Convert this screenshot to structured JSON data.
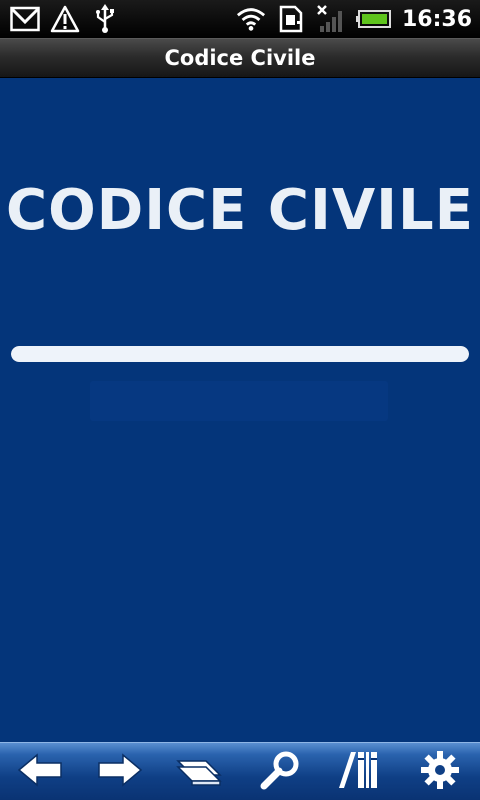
{
  "status_bar": {
    "time": "16:36",
    "left_icons": [
      "gmail-icon",
      "warning-icon",
      "usb-icon"
    ],
    "right_icons": [
      "wifi-icon",
      "sim-icon",
      "signal-icon",
      "battery-icon"
    ]
  },
  "title_bar": {
    "title": "Codice Civile"
  },
  "main": {
    "heading": "CODICE CIVILE",
    "progress": 1.0
  },
  "toolbar": {
    "buttons": [
      {
        "name": "back-button",
        "icon": "arrow-left-icon"
      },
      {
        "name": "forward-button",
        "icon": "arrow-right-icon"
      },
      {
        "name": "bookmarks-button",
        "icon": "book-stack-icon"
      },
      {
        "name": "search-button",
        "icon": "search-icon"
      },
      {
        "name": "library-button",
        "icon": "library-icon"
      },
      {
        "name": "settings-button",
        "icon": "gear-icon"
      }
    ]
  }
}
